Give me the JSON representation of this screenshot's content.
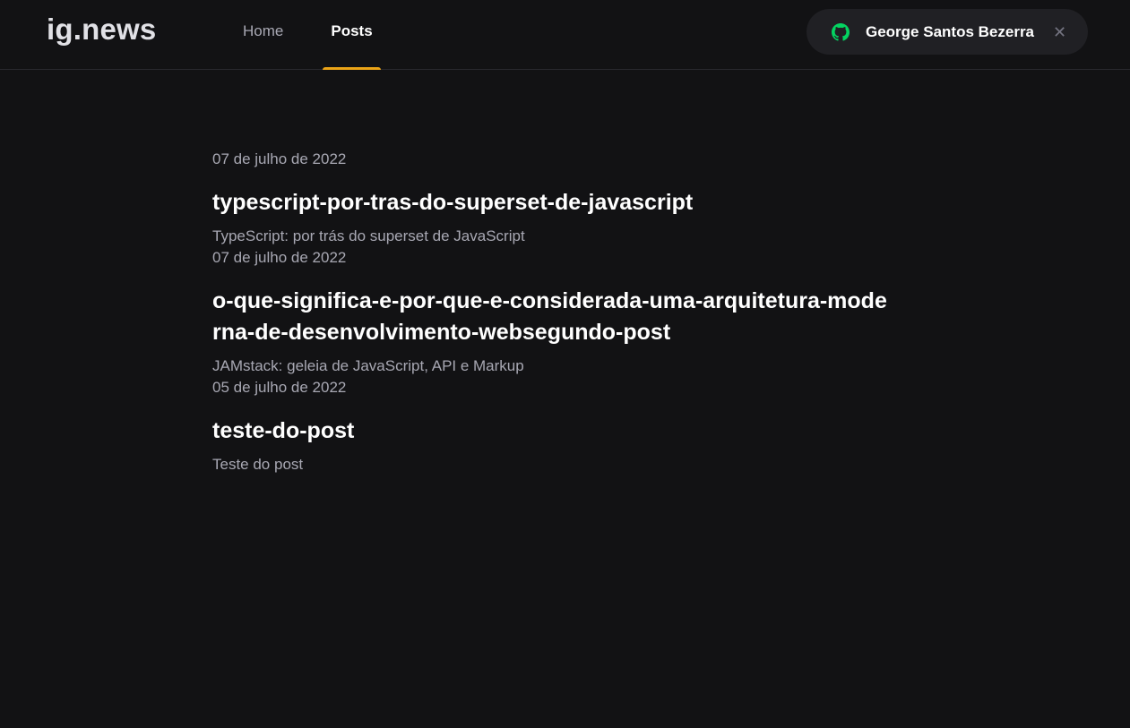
{
  "header": {
    "logo": "ig.news",
    "nav": [
      {
        "label": "Home",
        "active": false
      },
      {
        "label": "Posts",
        "active": true
      }
    ],
    "user": {
      "name": "George Santos Bezerra",
      "icon": "github-icon",
      "close_icon": "close-icon",
      "close_glyph": "✕",
      "icon_color": "#04d361"
    }
  },
  "posts": [
    {
      "date": "07 de julho de 2022",
      "title": "typescript-por-tras-do-superset-de-javascript",
      "excerpt": "TypeScript: por trás do superset de JavaScript"
    },
    {
      "date": "07 de julho de 2022",
      "title": "o-que-significa-e-por-que-e-considerada-uma-arquitetura-moderna-de-desenvolvimento-websegundo-post",
      "excerpt": "JAMstack: geleia de JavaScript, API e Markup"
    },
    {
      "date": "05 de julho de 2022",
      "title": "teste-do-post",
      "excerpt": "Teste do post"
    }
  ],
  "colors": {
    "background": "#121214",
    "accent": "#eba417",
    "github_green": "#04d361"
  }
}
